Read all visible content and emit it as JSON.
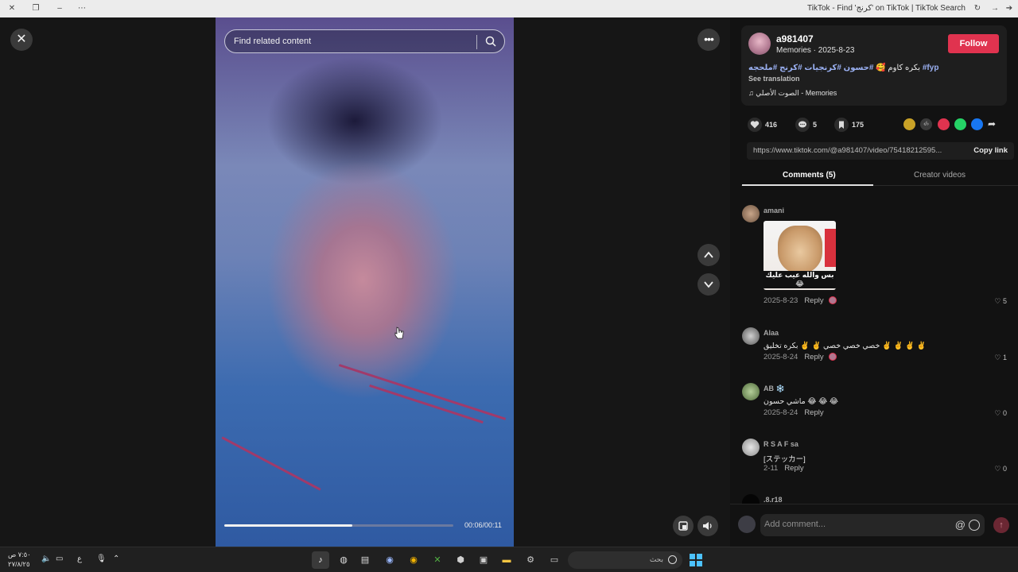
{
  "window": {
    "title": "TikTok - Find 'كرنج' on TikTok | TikTok Search"
  },
  "player": {
    "search_placeholder": "Find related content",
    "time": "00:06/00:11",
    "progress_percent": 56
  },
  "post": {
    "username": "a981407",
    "meta": "Memories · 2025-8-23",
    "follow_label": "Follow",
    "caption_text": "بكره كاوم 🥰",
    "caption_tags": "#حسون #كرنجيات #كرنج #ملحجه #fyp",
    "see_translation": "See translation",
    "music": "الصوت الأصلي - Memories",
    "likes": "416",
    "comments_count": "5",
    "saves": "175",
    "link_url": "https://www.tiktok.com/@a981407/video/75418212595...",
    "copy_link": "Copy link"
  },
  "tabs": {
    "comments": "Comments (5)",
    "creator_videos": "Creator videos"
  },
  "comments": [
    {
      "name": "amani",
      "text": "",
      "sticker_caption": "بس والله عيب عليك 😂",
      "date": "2025-8-23",
      "reply": "Reply",
      "likes": "5",
      "creator_liked": true
    },
    {
      "name": "Alaa",
      "text": "خصي خصي خصي ✌️ ✌️ بكره تخليق ✌️ ✌️ ✌️ ✌️",
      "date": "2025-8-24",
      "reply": "Reply",
      "likes": "1",
      "creator_liked": true
    },
    {
      "name": "AB ❄️",
      "text": "ماشي حسون 😂 😂 😂",
      "date": "2025-8-24",
      "reply": "Reply",
      "likes": "0",
      "creator_liked": false
    },
    {
      "name": "R S A F sa",
      "text": "[ステッカー]",
      "date": "2-11",
      "reply": "Reply",
      "likes": "0",
      "creator_liked": false
    },
    {
      "name": ".8.r18",
      "text": "",
      "date": "",
      "reply": "",
      "likes": "",
      "creator_liked": false
    }
  ],
  "add_comment": {
    "placeholder": "Add comment...",
    "at_symbol": "@"
  },
  "taskbar": {
    "clock_time": "٧:٥٠ ص",
    "clock_date": "٢٧/٨/٢٥",
    "search_label": "بحث",
    "lang": "ع"
  },
  "colors": {
    "follow": "#e0334f",
    "hashtag": "#9ab0f2",
    "accent": "#4cc2ff"
  }
}
